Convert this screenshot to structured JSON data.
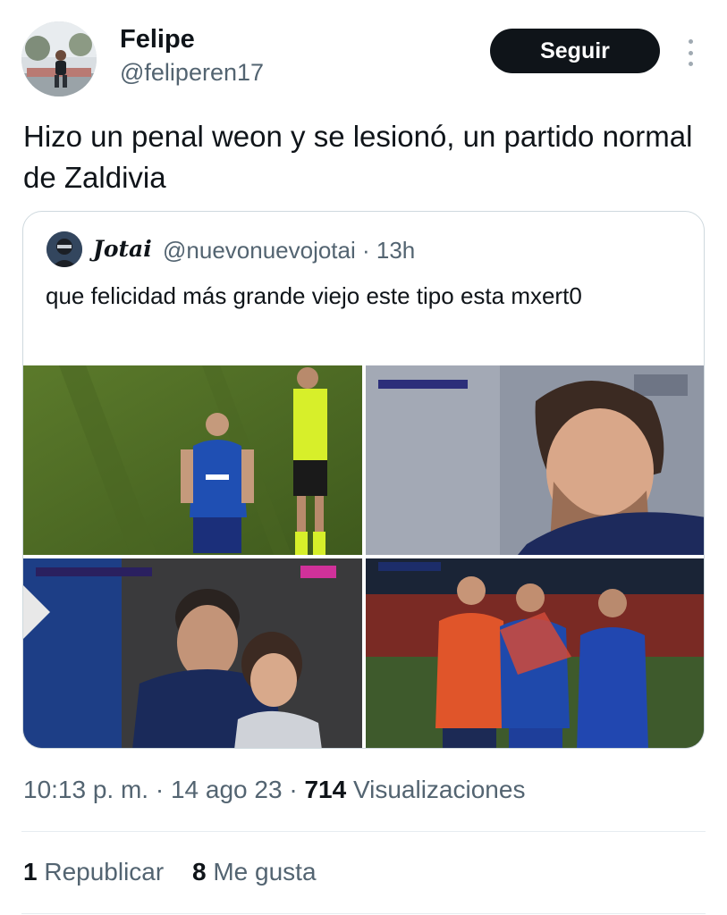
{
  "author": {
    "name": "Felipe",
    "handle": "@feliperen17",
    "follow_label": "Seguir"
  },
  "tweet": {
    "text": "Hizo un penal weon y se lesionó, un partido normal de Zaldivia"
  },
  "quoted": {
    "name": "Jotai",
    "handle_time": "@nuevonuevojotai · 13h",
    "text": "que felicidad más grande viejo este tipo esta mxert0",
    "images": [
      {
        "alt": "soccer-player-arguing-with-referee"
      },
      {
        "alt": "player-grimacing-in-pain"
      },
      {
        "alt": "player-sitting-in-stands"
      },
      {
        "alt": "injured-player-helped-off-field"
      }
    ]
  },
  "meta": {
    "time": "10:13 p. m.",
    "date": "14 ago 23",
    "views": "714",
    "views_label": "Visualizaciones"
  },
  "stats": {
    "reposts": "1",
    "reposts_label": "Republicar",
    "likes": "8",
    "likes_label": "Me gusta"
  },
  "colors": {
    "text": "#0f1419",
    "secondary": "#536471",
    "border": "#cfd9de",
    "button": "#0f1419"
  }
}
